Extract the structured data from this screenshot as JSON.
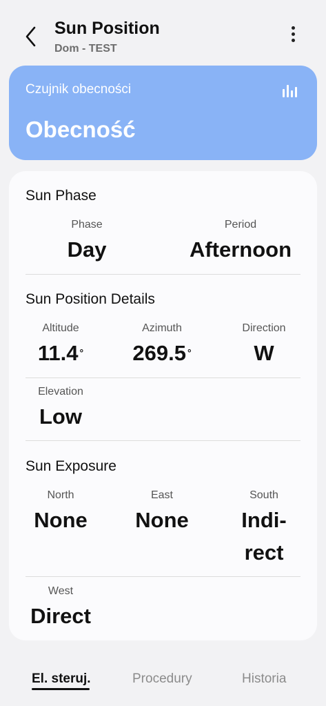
{
  "header": {
    "title": "Sun Position",
    "subtitle": "Dom - TEST",
    "back_icon": "chevron-left-icon",
    "more_icon": "more-vertical-icon"
  },
  "status_card": {
    "sensor_label": "Czujnik obecności",
    "value": "Obecność",
    "icon": "bar-chart-icon",
    "color": "#89b3f6"
  },
  "sun_phase": {
    "title": "Sun Phase",
    "phase": {
      "label": "Phase",
      "value": "Day"
    },
    "period": {
      "label": "Period",
      "value": "Afternoon"
    }
  },
  "sun_position": {
    "title": "Sun Position Details",
    "altitude": {
      "label": "Altitude",
      "value": "11.4",
      "unit": "°"
    },
    "azimuth": {
      "label": "Azimuth",
      "value": "269.5",
      "unit": "°"
    },
    "direction": {
      "label": "Direction",
      "value": "W"
    },
    "elevation": {
      "label": "Elevation",
      "value": "Low"
    }
  },
  "sun_exposure": {
    "title": "Sun Exposure",
    "north": {
      "label": "North",
      "value": "None"
    },
    "east": {
      "label": "East",
      "value": "None"
    },
    "south": {
      "label": "South",
      "value_line1": "Indi-",
      "value_line2": "rect"
    },
    "west": {
      "label": "West",
      "value": "Direct"
    }
  },
  "tabs": [
    {
      "label": "El. steruj.",
      "active": true
    },
    {
      "label": "Procedury",
      "active": false
    },
    {
      "label": "Historia",
      "active": false
    }
  ]
}
